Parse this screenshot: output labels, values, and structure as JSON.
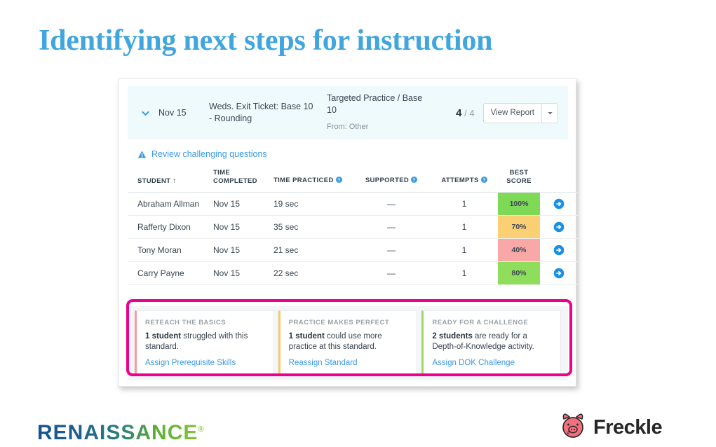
{
  "slide": {
    "title": "Identifying next steps for instruction",
    "title_color": "#41a6dd",
    "annotation_color": "#ec008c"
  },
  "assignment_header": {
    "chevron_icon": "chevron-down-icon",
    "date": "Nov 15",
    "name": "Weds. Exit Ticket: Base 10 - Rounding",
    "standard": "Targeted Practice / Base 10",
    "from": "From: Other",
    "score_completed": "4",
    "score_total": "/ 4",
    "view_report_label": "View Report",
    "caret_icon": "caret-down-icon"
  },
  "review": {
    "icon": "warning-triangle-icon",
    "link_label": "Review challenging questions"
  },
  "table": {
    "columns": [
      "STUDENT ↑",
      "TIME COMPLETED",
      "TIME PRACTICED",
      "SUPPORTED",
      "ATTEMPTS",
      "BEST SCORE"
    ],
    "column_best_score_line1": "BEST",
    "column_best_score_line2": "SCORE",
    "help_icon": "help-circle-icon",
    "row_arrow_icon": "arrow-right-circle-icon",
    "rows": [
      {
        "student": "Abraham Allman",
        "time_completed": "Nov 15",
        "time_practiced": "19 sec",
        "supported": "—",
        "attempts": "1",
        "best_score": "100%",
        "score_color": "#7ed957"
      },
      {
        "student": "Rafferty Dixon",
        "time_completed": "Nov 15",
        "time_practiced": "35 sec",
        "supported": "—",
        "attempts": "1",
        "best_score": "70%",
        "score_color": "#fbcf73"
      },
      {
        "student": "Tony Moran",
        "time_completed": "Nov 15",
        "time_practiced": "21 sec",
        "supported": "—",
        "attempts": "1",
        "best_score": "40%",
        "score_color": "#f9a8a8"
      },
      {
        "student": "Carry Payne",
        "time_completed": "Nov 15",
        "time_practiced": "22 sec",
        "supported": "—",
        "attempts": "1",
        "best_score": "80%",
        "score_color": "#8ede5c"
      }
    ]
  },
  "recommendations": [
    {
      "title": "RETEACH THE BASICS",
      "count": "1 student",
      "body": " struggled with this standard.",
      "link": "Assign Prerequisite Skills",
      "accent": "#f79aa5"
    },
    {
      "title": "PRACTICE MAKES PERFECT",
      "count": "1 student",
      "body": " could use more practice at this standard.",
      "link": "Reassign Standard",
      "accent": "#f6c86a"
    },
    {
      "title": "READY FOR A CHALLENGE",
      "count": "2 students",
      "body": " are ready for a Depth-of-Knowledge activity.",
      "link": "Assign DOK Challenge",
      "accent": "#a2d86b"
    }
  ],
  "footer": {
    "renaissance_name": "RENAISSANCE",
    "renaissance_mark": "®",
    "freckle_name": "Freckle",
    "freckle_icon": "pig-face-icon"
  }
}
